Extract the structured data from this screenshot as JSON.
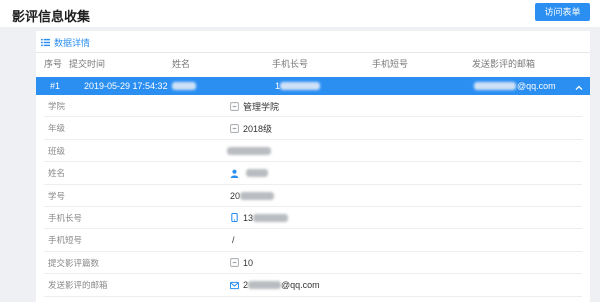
{
  "app": {
    "title": "影评信息收集",
    "visit_form_label": "访问表单"
  },
  "section": {
    "title": "数据详情",
    "icon": "list-icon"
  },
  "table": {
    "columns": [
      "序号",
      "提交时间",
      "姓名",
      "手机长号",
      "手机短号",
      "发送影评的邮箱"
    ],
    "row": {
      "index": "#1",
      "submitted_at": "2019-05-29 17:54:32",
      "phone_prefix": "1",
      "email_suffix": "@qq.com",
      "expand_icon": "chevron-up-icon"
    }
  },
  "details": [
    {
      "label": "学院",
      "icon": "field-icon",
      "value": "管理学院"
    },
    {
      "label": "年级",
      "icon": "field-icon",
      "value": "2018级"
    },
    {
      "label": "班级"
    },
    {
      "label": "姓名",
      "icon": "user-icon"
    },
    {
      "label": "学号",
      "value": "20"
    },
    {
      "label": "手机长号",
      "icon": "phone-icon",
      "value": "13"
    },
    {
      "label": "手机短号",
      "value": "/"
    },
    {
      "label": "提交影评篇数",
      "icon": "field-icon",
      "value": "10"
    },
    {
      "label": "发送影评的邮箱",
      "icon": "mail-icon",
      "value_prefix": "2",
      "value_suffix": "@qq.com"
    }
  ],
  "colors": {
    "accent": "#2b8ff2",
    "page_background": "#eef0f3"
  }
}
